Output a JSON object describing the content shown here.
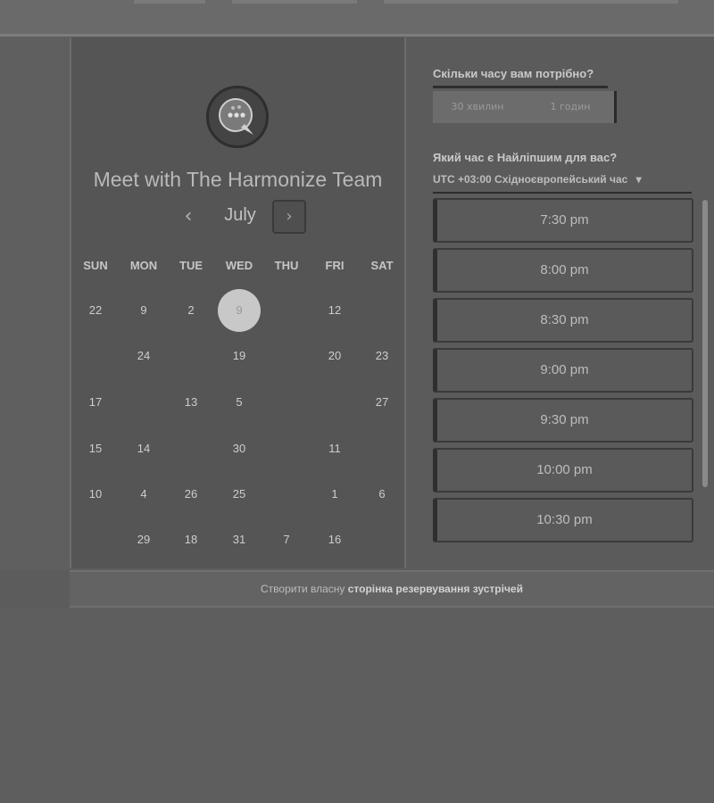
{
  "calendar": {
    "title": "Meet with The Harmonize Team",
    "month": "July",
    "prev_icon": "‹",
    "next_icon": "›",
    "weekdays": [
      "SUN",
      "MON",
      "TUE",
      "WED",
      "THU",
      "FRI",
      "SAT"
    ],
    "selected_day": "9",
    "rows": [
      [
        "22",
        "9",
        "2",
        "9",
        "",
        "12",
        ""
      ],
      [
        "",
        "24",
        "",
        "19",
        "",
        "20",
        "23"
      ],
      [
        "17",
        "",
        "13",
        "5",
        "",
        "",
        "27"
      ],
      [
        "15",
        "14",
        "",
        "30",
        "",
        "11",
        ""
      ],
      [
        "10",
        "4",
        "26",
        "25",
        "",
        "1",
        "6"
      ],
      [
        "",
        "29",
        "18",
        "31",
        "7",
        "16",
        ""
      ]
    ]
  },
  "booking": {
    "duration_question": "Скільки часу вам потрібно?",
    "duration_options": [
      "30 хвилин",
      "1 годин"
    ],
    "time_question": "Який час є Найліпшим для вас?",
    "timezone": "UTC +03:00 Східноєвропейський час",
    "timezone_caret": "▾",
    "slots": [
      "7:30 pm",
      "8:00 pm",
      "8:30 pm",
      "9:00 pm",
      "9:30 pm",
      "10:00 pm",
      "10:30 pm"
    ]
  },
  "footer": {
    "prefix": "Створити власну",
    "link": "сторінка резервування зустрічей"
  },
  "icons": {
    "logo": "chat-bubble-logo-icon",
    "prev": "chevron-left-icon",
    "next": "chevron-right-icon"
  }
}
